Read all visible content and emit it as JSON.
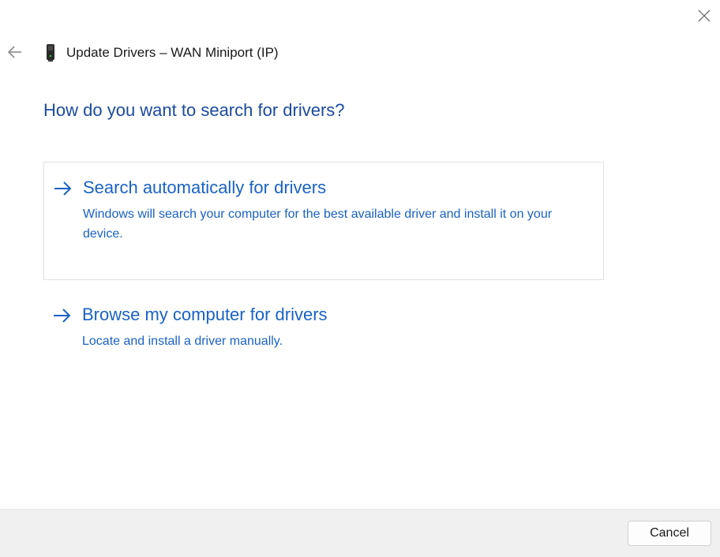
{
  "window": {
    "close_icon": "close-icon",
    "back_icon": "back-arrow-icon"
  },
  "header": {
    "device_icon": "network-adapter-icon",
    "title": "Update Drivers – WAN Miniport (IP)"
  },
  "main": {
    "heading": "How do you want to search for drivers?",
    "options": [
      {
        "icon": "arrow-right-icon",
        "title": "Search automatically for drivers",
        "description": "Windows will search your computer for the best available driver and install it on your device."
      },
      {
        "icon": "arrow-right-icon",
        "title": "Browse my computer for drivers",
        "description": "Locate and install a driver manually."
      }
    ]
  },
  "footer": {
    "cancel_label": "Cancel"
  },
  "colors": {
    "heading": "#1b4aa0",
    "link": "#1a62c4",
    "footer_bg": "#f0f0f0",
    "option_border": "#e1e1e1"
  }
}
